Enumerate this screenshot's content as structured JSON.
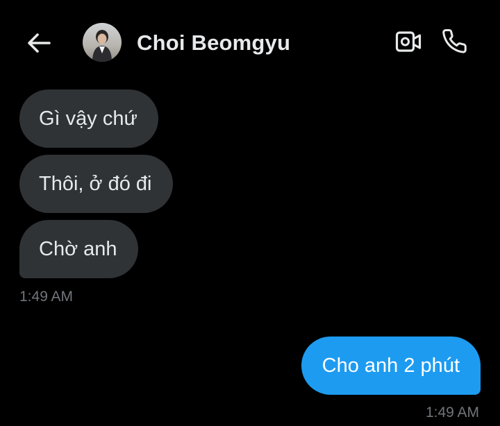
{
  "header": {
    "back_icon": "arrow-left-icon",
    "contact_name": "Choi Beomgyu",
    "avatar_icon": "avatar-photo",
    "video_icon": "video-camera-icon",
    "call_icon": "phone-icon"
  },
  "messages": {
    "received": [
      {
        "text": "Gì vậy chứ"
      },
      {
        "text": "Thôi, ở đó đi"
      },
      {
        "text": "Chờ anh"
      }
    ],
    "received_time": "1:49 AM",
    "sent": [
      {
        "text": "Cho anh 2 phút"
      }
    ],
    "sent_time": "1:49 AM"
  },
  "colors": {
    "background": "#000000",
    "incoming_bubble": "#2f3336",
    "outgoing_bubble": "#1d9bf0",
    "timestamp": "#71767b",
    "text": "#e7e9ea"
  }
}
